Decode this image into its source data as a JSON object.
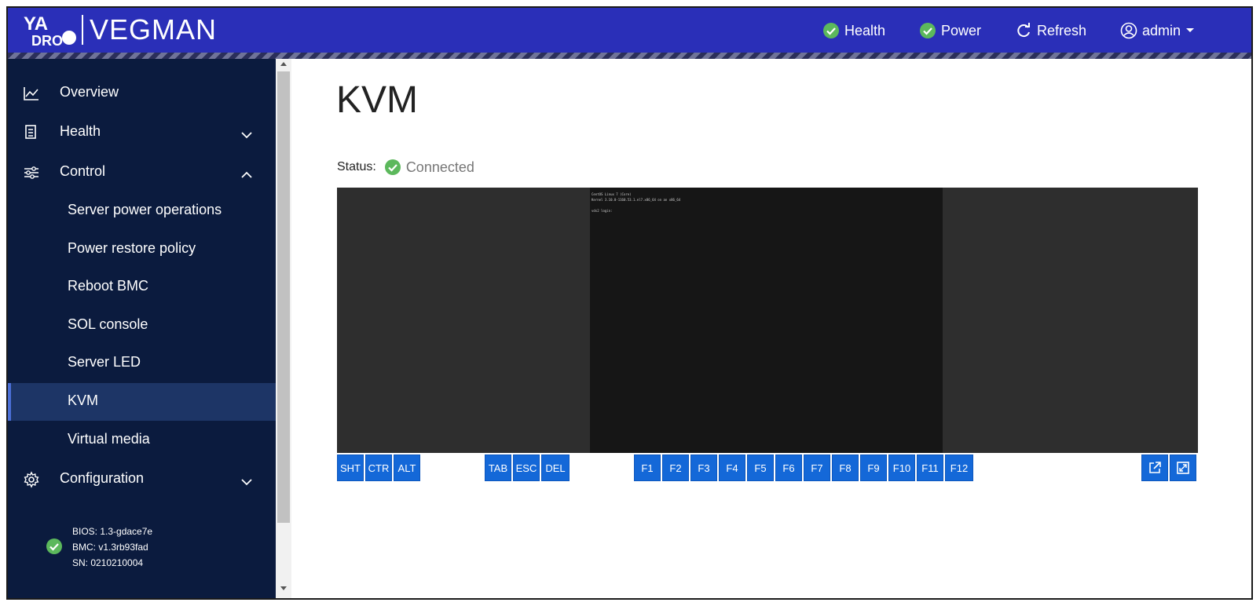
{
  "header": {
    "brand": "VEGMAN",
    "health_label": "Health",
    "power_label": "Power",
    "refresh_label": "Refresh",
    "user_label": "admin",
    "status_color": "#4caf50",
    "bar_color": "#2a2fb8"
  },
  "sidebar": {
    "items": [
      {
        "label": "Overview",
        "icon": "chart-line-icon"
      },
      {
        "label": "Health",
        "icon": "clipboard-list-icon"
      },
      {
        "label": "Control",
        "icon": "sliders-icon"
      },
      {
        "label": "Configuration",
        "icon": "gear-icon"
      }
    ],
    "control_subitems": [
      "Server power operations",
      "Power restore policy",
      "Reboot BMC",
      "SOL console",
      "Server LED",
      "KVM",
      "Virtual media"
    ],
    "active_item": "KVM",
    "system_info": {
      "bios": "BIOS: 1.3-gdace7e",
      "bmc": "BMC: v1.3rb93fad",
      "sn": "SN: 0210210004"
    }
  },
  "main": {
    "title": "KVM",
    "status_label": "Status:",
    "status_value": "Connected",
    "console_lines": [
      "CentOS Linux 7 (Core)",
      "Kernel 3.10.0-1160.53.1.el7.x86_64 on an x86_64",
      "vds2 login:"
    ],
    "key_buttons": [
      "SHT",
      "CTR",
      "ALT",
      "TAB",
      "ESC",
      "DEL",
      "F1",
      "F2",
      "F3",
      "F4",
      "F5",
      "F6",
      "F7",
      "F8",
      "F9",
      "F10",
      "F11",
      "F12"
    ],
    "action_buttons": [
      "open-in-new-window-icon",
      "fullscreen-icon"
    ]
  }
}
